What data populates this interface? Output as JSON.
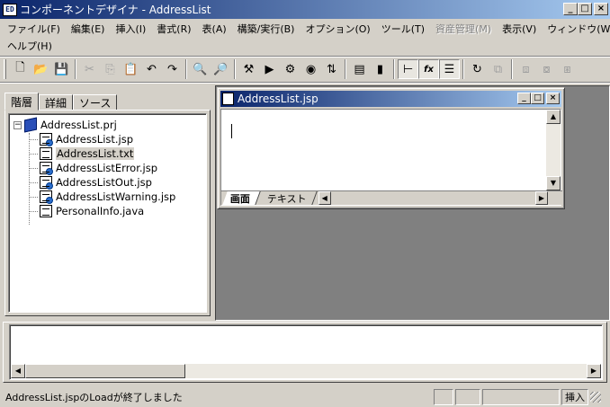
{
  "window": {
    "icon_label": "ED",
    "title": "コンポーネントデザイナ - AddressList",
    "buttons": {
      "minimize": "_",
      "maximize": "□",
      "close": "×"
    }
  },
  "menu": {
    "row1": [
      {
        "label": "ファイル(F)",
        "disabled": false
      },
      {
        "label": "編集(E)",
        "disabled": false
      },
      {
        "label": "挿入(I)",
        "disabled": false
      },
      {
        "label": "書式(R)",
        "disabled": false
      },
      {
        "label": "表(A)",
        "disabled": false
      },
      {
        "label": "構築/実行(B)",
        "disabled": false
      },
      {
        "label": "オプション(O)",
        "disabled": false
      },
      {
        "label": "ツール(T)",
        "disabled": false
      },
      {
        "label": "資産管理(M)",
        "disabled": true
      },
      {
        "label": "表示(V)",
        "disabled": false
      },
      {
        "label": "ウィンドウ(W)",
        "disabled": false
      }
    ],
    "row2": [
      {
        "label": "ヘルプ(H)",
        "disabled": false
      }
    ]
  },
  "toolbar": {
    "buttons": [
      {
        "name": "new-file-icon",
        "glyph": "🗋"
      },
      {
        "name": "open-folder-icon",
        "glyph": "📂"
      },
      {
        "name": "save-icon",
        "glyph": "💾"
      },
      {
        "sep": true
      },
      {
        "name": "cut-icon",
        "glyph": "✂",
        "dim": true
      },
      {
        "name": "copy-icon",
        "glyph": "⎘",
        "dim": true
      },
      {
        "name": "paste-icon",
        "glyph": "📋"
      },
      {
        "name": "undo-icon",
        "glyph": "↶"
      },
      {
        "name": "redo-icon",
        "glyph": "↷"
      },
      {
        "sep": true
      },
      {
        "name": "find-icon",
        "glyph": "🔍"
      },
      {
        "name": "find-next-icon",
        "glyph": "🔎",
        "dim": true
      },
      {
        "sep": true
      },
      {
        "name": "build-icon",
        "glyph": "⚒"
      },
      {
        "name": "run-icon",
        "glyph": "▶"
      },
      {
        "name": "run-all-icon",
        "glyph": "⚙"
      },
      {
        "name": "stop-icon",
        "glyph": "◉"
      },
      {
        "name": "sort-icon",
        "glyph": "⇅"
      },
      {
        "sep": true
      },
      {
        "name": "properties-icon",
        "glyph": "▤"
      },
      {
        "name": "bookmark-icon",
        "glyph": "▮"
      },
      {
        "sep": true
      },
      {
        "name": "tree-view-icon",
        "glyph": "⊢",
        "pressed": true
      },
      {
        "name": "function-icon",
        "glyph": "fx",
        "pressed": true
      },
      {
        "name": "comment-icon",
        "glyph": "☰",
        "pressed": true
      },
      {
        "sep": true
      },
      {
        "name": "refresh-icon",
        "glyph": "↻"
      },
      {
        "name": "component-icon",
        "glyph": "⧉",
        "dim": true
      },
      {
        "sep": true
      },
      {
        "name": "window-cascade-icon",
        "glyph": "⧈",
        "dim": true
      },
      {
        "name": "window-tile-icon",
        "glyph": "⧇",
        "dim": true
      },
      {
        "name": "window-arrange-icon",
        "glyph": "⧆",
        "dim": true
      }
    ]
  },
  "left_pane": {
    "tabs": [
      "階層",
      "詳細",
      "ソース"
    ],
    "active_tab": 0,
    "tree": {
      "root": {
        "label": "AddressList.prj",
        "expander": "−"
      },
      "children": [
        "AddressList.jsp",
        "AddressList.txt",
        "AddressListError.jsp",
        "AddressListOut.jsp",
        "AddressListWarning.jsp",
        "PersonalInfo.java"
      ],
      "selected_index": 1
    }
  },
  "child_window": {
    "title": "AddressList.jsp",
    "sheet_tabs": [
      "画面",
      "テキスト"
    ],
    "active_sheet": 0,
    "scroll_up": "▲",
    "scroll_down": "▼",
    "scroll_left": "◀",
    "scroll_right": "▶"
  },
  "output": {
    "scroll_left": "◀",
    "scroll_right": "▶"
  },
  "status": {
    "message": "AddressList.jspのLoadが終了しました",
    "mode": "挿入"
  }
}
